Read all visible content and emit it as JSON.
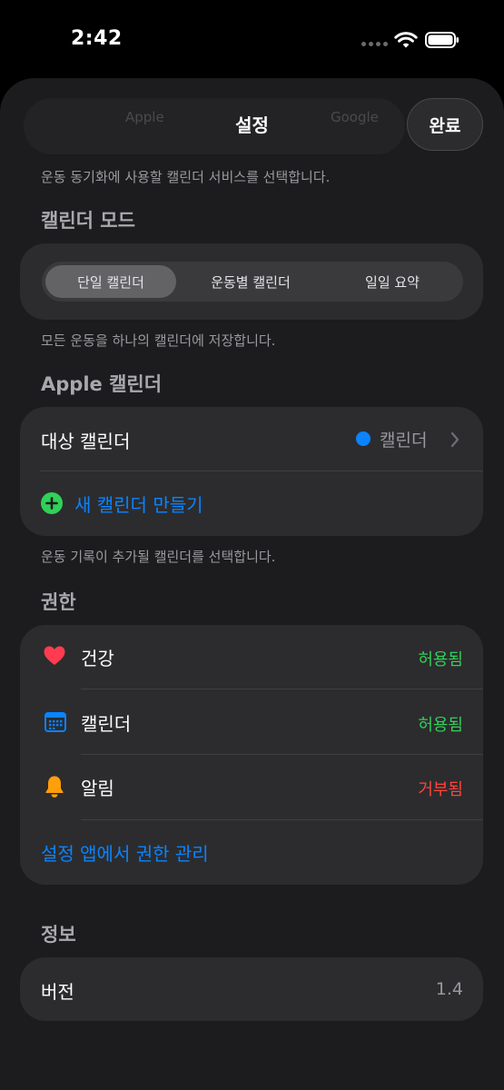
{
  "status_bar": {
    "time": "2:42"
  },
  "nav": {
    "title": "설정",
    "done_label": "완료",
    "ghost_left": "Apple",
    "ghost_right": "Google"
  },
  "service_footnote": "운동 동기화에 사용할 캘린더 서비스를 선택합니다.",
  "calendar_mode": {
    "title": "캘린더 모드",
    "options": [
      "단일 캘린더",
      "운동별 캘린더",
      "일일 요약"
    ],
    "selected_index": 0,
    "footnote": "모든 운동을 하나의 캘린더에 저장합니다."
  },
  "apple_calendar": {
    "title": "Apple 캘린더",
    "target_label": "대상 캘린더",
    "target_value": "캘린더",
    "target_color": "#0a84ff",
    "create_label": "새 캘린더 만들기",
    "footnote": "운동 기록이 추가될 캘린더를 선택합니다."
  },
  "permissions": {
    "title": "권한",
    "items": [
      {
        "label": "건강",
        "status": "허용됨",
        "status_color": "#30d158",
        "icon": "heart-icon"
      },
      {
        "label": "캘린더",
        "status": "허용됨",
        "status_color": "#30d158",
        "icon": "calendar-icon"
      },
      {
        "label": "알림",
        "status": "거부됨",
        "status_color": "#ff453a",
        "icon": "bell-icon"
      }
    ],
    "manage_label": "설정 앱에서 권한 관리"
  },
  "info": {
    "title": "정보",
    "version_label": "버전",
    "version_value": "1.4"
  }
}
